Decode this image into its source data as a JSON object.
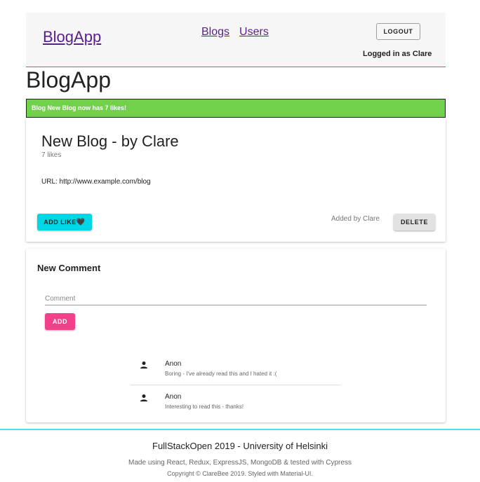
{
  "header": {
    "brand": "BlogApp",
    "nav": [
      {
        "label": "Blogs"
      },
      {
        "label": "Users"
      }
    ],
    "logout_label": "LOGOUT",
    "logged_in_text": "Logged in as Clare"
  },
  "page_title": "BlogApp",
  "notification": {
    "text": "Blog New Blog now has 7 likes!",
    "color": "#72d14b"
  },
  "blog": {
    "title": "New Blog - by Clare",
    "likes": "7 likes",
    "url": "URL: http://www.example.com/blog",
    "like_button": "ADD LIKE",
    "like_icon": "black-heart-icon",
    "added_by": "Added by Clare",
    "delete_button": "DELETE"
  },
  "comments": {
    "heading": "New Comment",
    "input_placeholder": "Comment",
    "add_button": "ADD",
    "items": [
      {
        "author": "Anon",
        "text": "Boring - I've already read this and I hated it :(",
        "icon": "person-icon"
      },
      {
        "author": "Anon",
        "text": "Interesting to read this - thanks!",
        "icon": "person-icon"
      }
    ]
  },
  "footer": {
    "title": "FullStackOpen 2019 - University of Helsinki",
    "made_with": "Made using React, Redux, ExpressJS, MongoDB & tested with Cypress",
    "copyright": "Copyright © ClareBee 2019. Styled with Material-UI."
  },
  "colors": {
    "accent_cyan": "#00d7e6",
    "accent_pink": "#f0418a",
    "link_purple": "#5a1f8a"
  }
}
